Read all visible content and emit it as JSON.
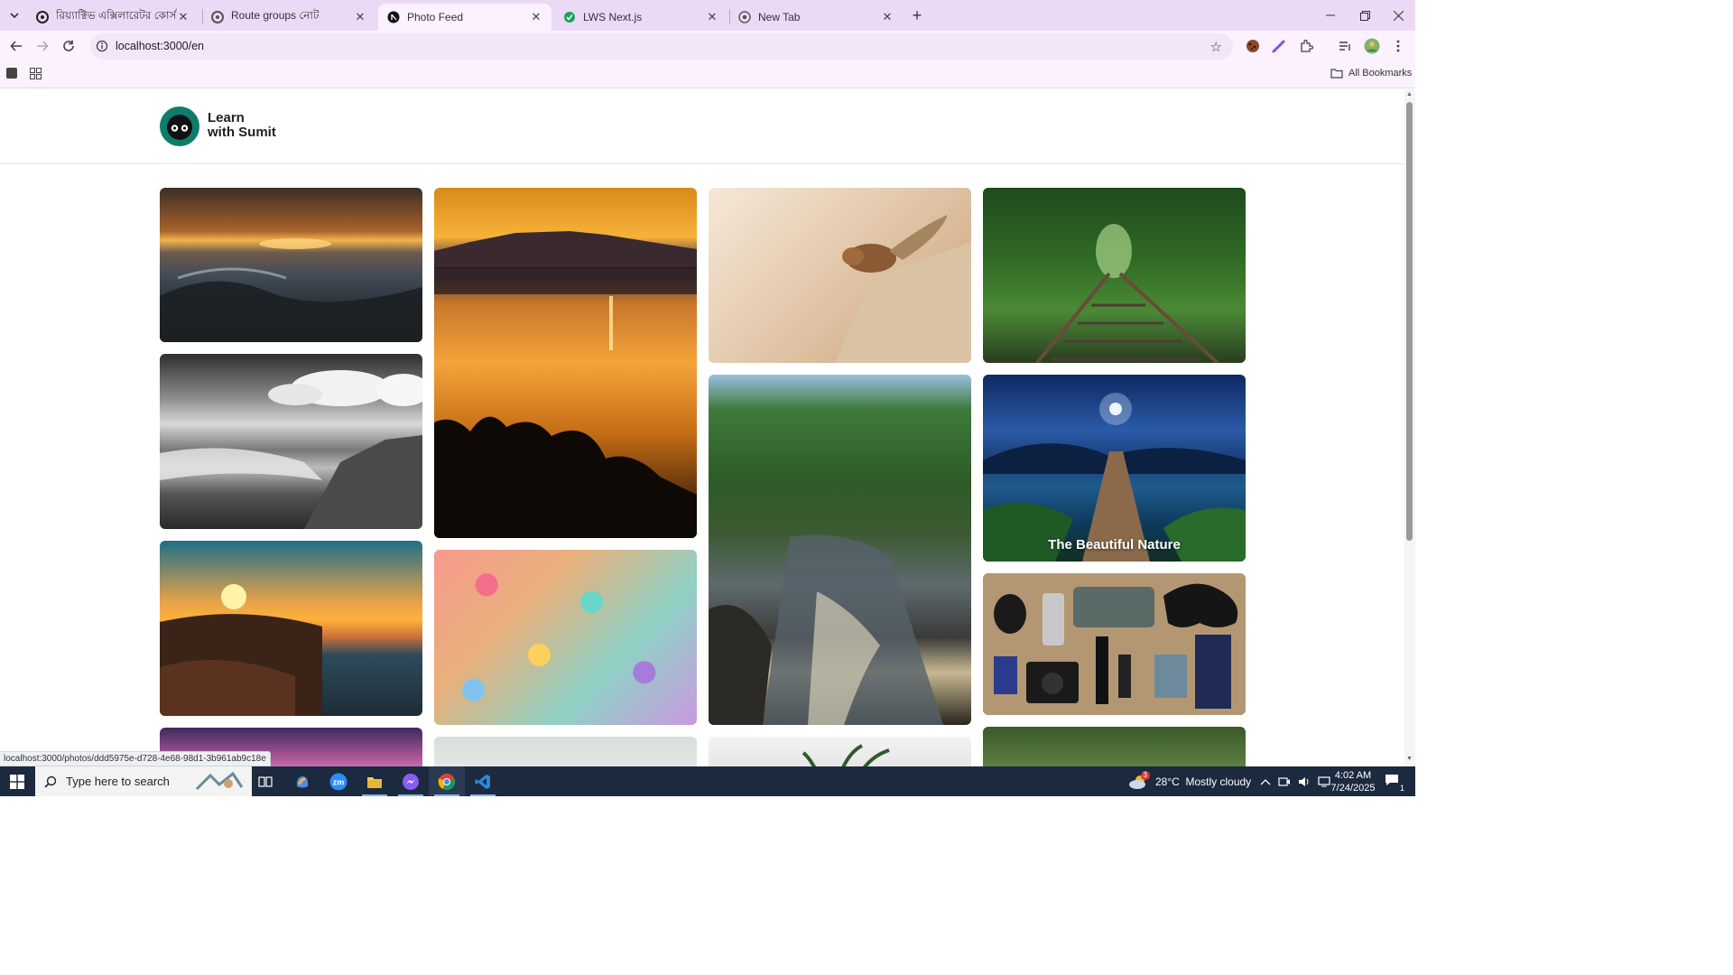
{
  "browser": {
    "tabs": [
      {
        "title": "রিয়্যাক্টিভ এক্সিলারেটর কোর্স লেসন",
        "active": false
      },
      {
        "title": "Route groups নোট",
        "active": false
      },
      {
        "title": "Photo Feed",
        "active": true
      },
      {
        "title": "LWS Next.js",
        "active": false
      },
      {
        "title": "New Tab",
        "active": false
      }
    ],
    "url": "localhost:3000/en",
    "all_bookmarks": "All Bookmarks",
    "status_url": "localhost:3000/photos/ddd5975e-d728-4e68-98d1-3b961ab9c18e"
  },
  "site": {
    "logo_line1": "Learn",
    "logo_line2": "with Sumit"
  },
  "photos": [
    {
      "name": "sunset-rocky-shore",
      "caption": ""
    },
    {
      "name": "lake-sunset",
      "caption": ""
    },
    {
      "name": "chipmunk",
      "caption": ""
    },
    {
      "name": "forest-railway",
      "caption": ""
    },
    {
      "name": "bw-seascape",
      "caption": ""
    },
    {
      "name": "river-forest",
      "caption": ""
    },
    {
      "name": "moonlit-pier",
      "caption": "The Beautiful Nature"
    },
    {
      "name": "sunset-rocks-sea",
      "caption": ""
    },
    {
      "name": "confetti",
      "caption": ""
    },
    {
      "name": "gadgets-flatlay",
      "caption": ""
    },
    {
      "name": "purple-sky",
      "caption": ""
    },
    {
      "name": "pale-photo",
      "caption": ""
    },
    {
      "name": "plant-photo",
      "caption": ""
    },
    {
      "name": "green-blur",
      "caption": ""
    }
  ],
  "taskbar": {
    "search_placeholder": "Type here to search",
    "weather": "28°C  Mostly cloudy",
    "weather_badge": "3",
    "time": "4:02 AM",
    "date": "7/24/2025",
    "notif_count": "1"
  }
}
